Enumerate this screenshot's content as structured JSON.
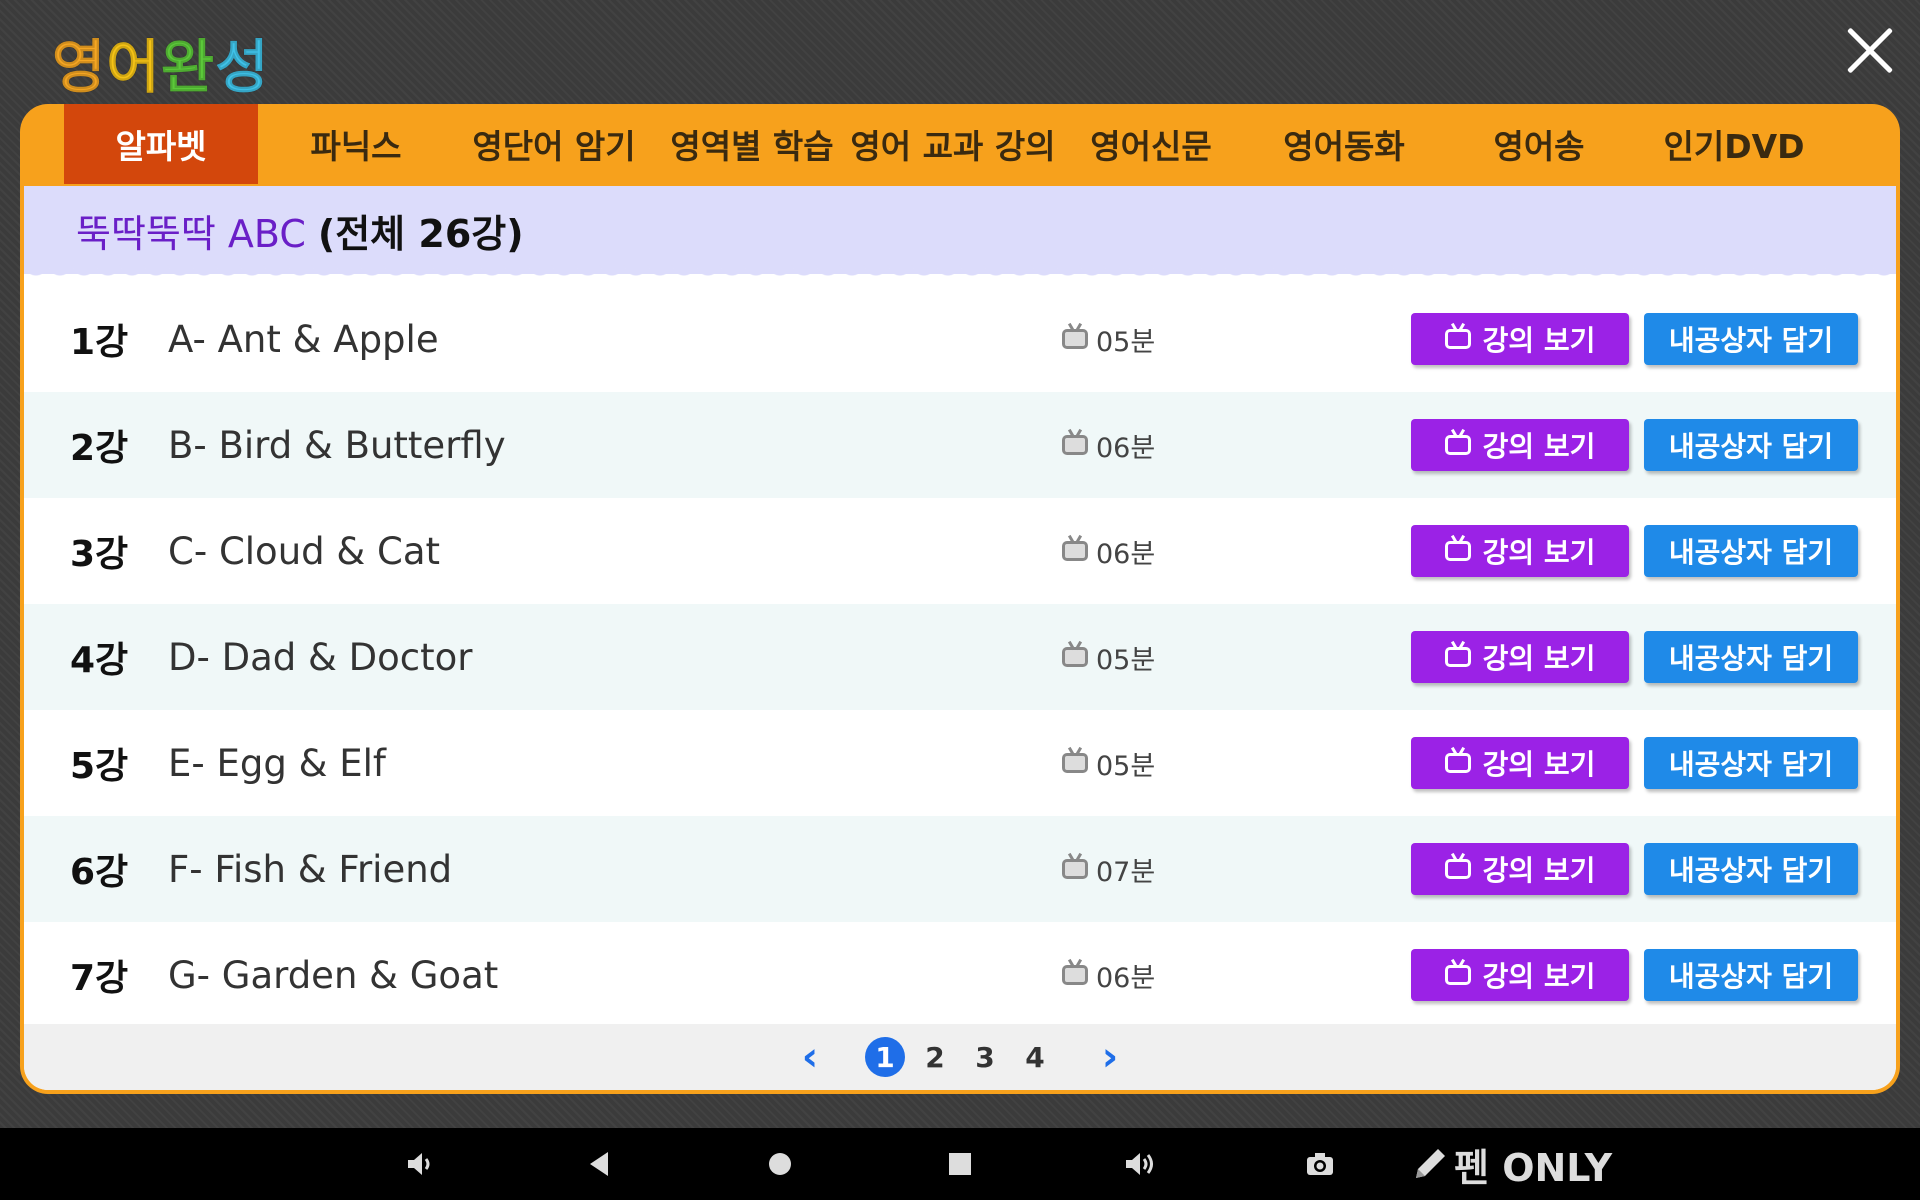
{
  "app": {
    "logo_chars": [
      {
        "char": "영",
        "color": "#f5a623"
      },
      {
        "char": "어",
        "color": "#f5c316"
      },
      {
        "char": "완",
        "color": "#5cc93a"
      },
      {
        "char": "성",
        "color": "#3fc2e8"
      }
    ]
  },
  "tabs": [
    {
      "label": "알파벳",
      "active": true
    },
    {
      "label": "파닉스",
      "active": false
    },
    {
      "label": "영단어 암기",
      "active": false
    },
    {
      "label": "영역별 학습",
      "active": false
    },
    {
      "label": "영어 교과 강의",
      "active": false
    },
    {
      "label": "영어신문",
      "active": false
    },
    {
      "label": "영어동화",
      "active": false
    },
    {
      "label": "영어송",
      "active": false
    },
    {
      "label": "인기DVD",
      "active": false
    }
  ],
  "series": {
    "title": "뚝딱뚝딱 ABC",
    "count": "(전체 26강)"
  },
  "lessons": [
    {
      "number": "1강",
      "title": "A- Ant & Apple",
      "duration": "05분"
    },
    {
      "number": "2강",
      "title": "B- Bird & Butterfly",
      "duration": "06분"
    },
    {
      "number": "3강",
      "title": "C- Cloud & Cat",
      "duration": "06분"
    },
    {
      "number": "4강",
      "title": "D- Dad & Doctor",
      "duration": "05분"
    },
    {
      "number": "5강",
      "title": "E- Egg & Elf",
      "duration": "05분"
    },
    {
      "number": "6강",
      "title": "F- Fish & Friend",
      "duration": "07분"
    },
    {
      "number": "7강",
      "title": "G- Garden & Goat",
      "duration": "06분"
    }
  ],
  "buttons": {
    "watch_label": "강의 보기",
    "save_label": "내공상자 담기"
  },
  "pagination": {
    "prev": "‹",
    "next": "›",
    "pages": [
      "1",
      "2",
      "3",
      "4"
    ],
    "current": "1"
  },
  "navbar": {
    "pen_label": "펜 ONLY",
    "icons": [
      "volume-down-icon",
      "back-icon",
      "home-icon",
      "recents-icon",
      "volume-up-icon",
      "camera-icon",
      "pen-icon"
    ]
  },
  "colors": {
    "accent_orange": "#f7a11c",
    "active_tab": "#d3470c",
    "watch_button": "#9b22e6",
    "save_button": "#1f8ae8",
    "header_band": "#dcdcfb",
    "series_title": "#6a1fc7"
  }
}
